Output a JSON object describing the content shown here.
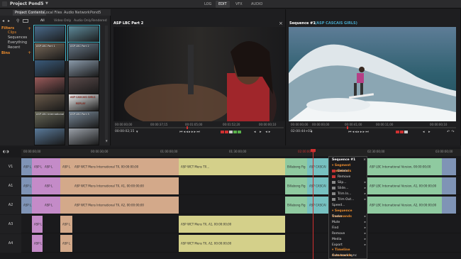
{
  "app": {
    "project_title": "Project Pond5",
    "project_dropdown": "▼",
    "modes": [
      "LOG",
      "EDIT",
      "VFX",
      "AUDIO"
    ],
    "active_mode": "EDIT"
  },
  "left_panel": {
    "tabs": [
      "Project Contents",
      "Local Files",
      "Audio Network",
      "Pond5"
    ],
    "filters_label": "Filters",
    "filters": [
      "Clips",
      "Sequences",
      "Everything",
      "Recent"
    ],
    "bins_label": "Bins",
    "sub_tabs": [
      "All",
      "Video Only",
      "Audio Only",
      "Rendered"
    ],
    "thumbs": [
      {
        "label": "",
        "color": "#4a6a8a"
      },
      {
        "label": "",
        "color": "#5e8a9a"
      },
      {
        "label": "ASP LBC Part 1",
        "color": "#7a6a5a"
      },
      {
        "label": "ASP LBC Part 2",
        "color": "#6a7a8a"
      },
      {
        "label": "",
        "color": "#3a5a7a"
      },
      {
        "label": "",
        "color": "#8a9aaa"
      },
      {
        "label": "",
        "color": "#9a5a5a"
      },
      {
        "label": "",
        "color": "#5a4a4a"
      },
      {
        "label": "",
        "color": "#6a5a4a"
      },
      {
        "label": "ASP CASCAIS GIRLS",
        "color": "#eeeeee"
      },
      {
        "label": "ASP LBC International",
        "color": "#6a6a5a"
      },
      {
        "label": "ASP LBC Part 3",
        "color": "#7a8a9a"
      },
      {
        "label": "",
        "color": "#5a7a9a"
      },
      {
        "label": "",
        "color": "#9aa0a8"
      }
    ],
    "replay_label": "REPLAY"
  },
  "source_viewer": {
    "title": "ASP LBC Part 2",
    "close": "×",
    "timecodes": [
      "00:00:00;00",
      "00:00:37;15",
      "00:01:05;00",
      "00:01:52;20",
      "00:00:00;10"
    ],
    "current_tc": "00:00:02;15"
  },
  "record_viewer": {
    "title": "Sequence #1",
    "subtitle": "(ASP CASCAIS GIRLS)",
    "timecodes": [
      "00:00:00;00",
      "00:00:00;00",
      "00:00:41;00",
      "00:00:11;00",
      "00:00:00;10"
    ],
    "current_tc": "02:00:44+03"
  },
  "timeline": {
    "ruler_ticks": [
      "00:00:00;00",
      "00:00:30;00",
      "01:00:00;00",
      "01:30:00;00",
      "02:00:00;00",
      "02:30:00;00",
      "03:00:00;00"
    ],
    "playhead_tc": "02:00:44+03",
    "tracks": [
      "V1",
      "A1",
      "A2",
      "A3",
      "A4"
    ],
    "v1_clip_text": "ASP WCT Mens International TX, 00:00:00;00",
    "v1_clip_text2": "ASP WCT Mens TX...",
    "a_clip_text": "ASP WCT Mens International TX, A1, 00:00:00;00",
    "a2_clip_text": "ASP WCT Mens International TX, A2, 00:00:00;00",
    "a3_clip_text": "ASP WCT Mens TX, A1, 00:00:00;00",
    "a4_clip_text": "ASP WCT Mens TX, A2, 00:00:00;00",
    "v1_right_clip": "ASP LBC International Version, 00:00:00;00",
    "a_right_clip": "ASP LBC International Version, A1, 00:00:00;00",
    "a2_right_clip": "ASP LBC International Version, A2, 00:00:00;00",
    "small_clip": "ASP L",
    "billabong": "Billabong Fig",
    "cascais": "ASP CASCAI"
  },
  "context_menu": {
    "title": "Sequence #1",
    "segment_header": "Segment commands",
    "segment_items": [
      "Delete",
      "Remove",
      "Slip...",
      "Slide...",
      "Trim In...",
      "Trim Out...",
      "Speed..."
    ],
    "sequence_header": "Sequence Commands",
    "sequence_items": [
      "Tracks",
      "Mute",
      "Find",
      "Remove",
      "Media",
      "Export"
    ],
    "timeline_header": "Timeline Commands",
    "timeline_items": [
      "Auto track sync",
      "Appearance..."
    ]
  },
  "colors": {
    "accent_orange": "#ea8b2d",
    "teal": "#46a6c8",
    "clip_v": "#7f94b6",
    "clip_pink": "#c48bc8",
    "clip_tan": "#d3a98a",
    "clip_yellow": "#d4d08a",
    "clip_green": "#8fcaa0",
    "clip_teal": "#77c1c1",
    "playhead": "#d03030"
  }
}
